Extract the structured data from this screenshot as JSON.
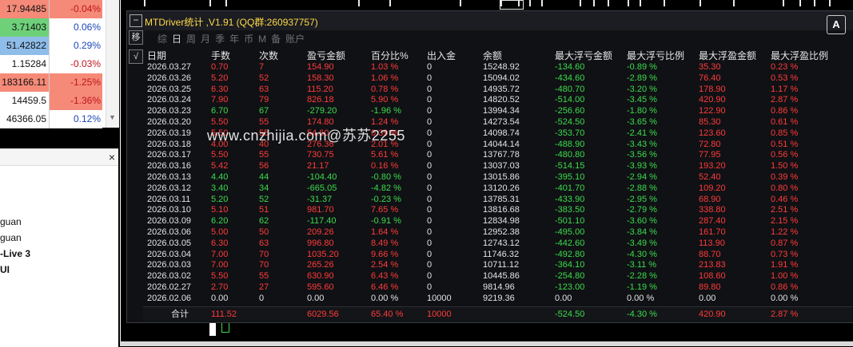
{
  "market_watch": {
    "rows": [
      {
        "price": "17.94485",
        "change": "-0.04%",
        "price_bg": "#f58a78",
        "change_bg": "#f58a78",
        "change_color": "#c0151c"
      },
      {
        "price": "3.71403",
        "change": "0.06%",
        "price_bg": "#6ed17a",
        "change_bg": "#ffffff",
        "change_color": "#1c47b7"
      },
      {
        "price": "51.42822",
        "change": "0.29%",
        "price_bg": "#8fbdea",
        "change_bg": "#ffffff",
        "change_color": "#1c47b7"
      },
      {
        "price": "1.15284",
        "change": "-0.03%",
        "price_bg": "#ffffff",
        "change_bg": "#ffffff",
        "change_color": "#c0151c"
      },
      {
        "price": "183166.11",
        "change": "-1.25%",
        "price_bg": "#f58a78",
        "change_bg": "#f58a78",
        "change_color": "#c0151c"
      },
      {
        "price": "14459.5",
        "change": "-1.36%",
        "price_bg": "#ffffff",
        "change_bg": "#f58a78",
        "change_color": "#c0151c"
      },
      {
        "price": "46366.05",
        "change": "0.12%",
        "price_bg": "#ffffff",
        "change_bg": "#ffffff",
        "change_color": "#1c47b7"
      }
    ]
  },
  "navigator": {
    "close_icon": "×",
    "items": [
      "guan",
      "guan",
      "-Live 3",
      "UI"
    ]
  },
  "panel": {
    "title": "MTDriver统计 ,V1.91 (QQ群:260937757)",
    "minimize_glyph": "−",
    "corner_icon": "A",
    "side_buttons": [
      "移",
      "√"
    ],
    "period_tabs": [
      "综",
      "日",
      "周",
      "月",
      "季",
      "年",
      "币",
      "M",
      "备",
      "账户"
    ],
    "active_tab": "日",
    "columns": [
      "日期",
      "手数",
      "次数",
      "盈亏金额",
      "百分比%",
      "出入金",
      "余额",
      "最大浮亏金额",
      "最大浮亏比例",
      "最大浮盈金额",
      "最大浮盈比例"
    ],
    "rows": [
      [
        "2026.03.27",
        "0.70",
        "7",
        "154.90",
        "1.03 %",
        "0",
        "15248.92",
        "-134.60",
        "-0.89 %",
        "35.30",
        "0.23 %"
      ],
      [
        "2026.03.26",
        "5.20",
        "52",
        "158.30",
        "1.06 %",
        "0",
        "15094.02",
        "-434.60",
        "-2.89 %",
        "76.40",
        "0.53 %"
      ],
      [
        "2026.03.25",
        "6.30",
        "63",
        "115.20",
        "0.78 %",
        "0",
        "14935.72",
        "-480.70",
        "-3.20 %",
        "178.90",
        "1.17 %"
      ],
      [
        "2026.03.24",
        "7.90",
        "79",
        "826.18",
        "5.90 %",
        "0",
        "14820.52",
        "-514.00",
        "-3.45 %",
        "420.90",
        "2.87 %"
      ],
      [
        "2026.03.23",
        "6.70",
        "67",
        "-279.20",
        "-1.96 %",
        "0",
        "13994.34",
        "-256.60",
        "-1.80 %",
        "122.90",
        "0.86 %"
      ],
      [
        "2026.03.20",
        "5.50",
        "55",
        "174.80",
        "1.24 %",
        "0",
        "14273.54",
        "-524.50",
        "-3.65 %",
        "85.30",
        "0.61 %"
      ],
      [
        "2026.03.19",
        "5.50",
        "55",
        "54.60",
        "0.39 %",
        "0",
        "14098.74",
        "-353.70",
        "-2.41 %",
        "123.60",
        "0.85 %"
      ],
      [
        "2026.03.18",
        "4.00",
        "40",
        "276.36",
        "2.01 %",
        "0",
        "14044.14",
        "-488.90",
        "-3.43 %",
        "72.80",
        "0.51 %"
      ],
      [
        "2026.03.17",
        "5.50",
        "55",
        "730.75",
        "5.61 %",
        "0",
        "13767.78",
        "-480.80",
        "-3.56 %",
        "77.95",
        "0.56 %"
      ],
      [
        "2026.03.16",
        "5.42",
        "56",
        "21.17",
        "0.16 %",
        "0",
        "13037.03",
        "-514.15",
        "-3.93 %",
        "193.20",
        "1.50 %"
      ],
      [
        "2026.03.13",
        "4.40",
        "44",
        "-104.40",
        "-0.80 %",
        "0",
        "13015.86",
        "-395.10",
        "-2.94 %",
        "52.40",
        "0.39 %"
      ],
      [
        "2026.03.12",
        "3.40",
        "34",
        "-665.05",
        "-4.82 %",
        "0",
        "13120.26",
        "-401.70",
        "-2.88 %",
        "109.20",
        "0.80 %"
      ],
      [
        "2026.03.11",
        "5.20",
        "52",
        "-31.37",
        "-0.23 %",
        "0",
        "13785.31",
        "-433.90",
        "-2.95 %",
        "68.90",
        "0.46 %"
      ],
      [
        "2026.03.10",
        "5.10",
        "51",
        "981.70",
        "7.65 %",
        "0",
        "13816.68",
        "-383.50",
        "-2.79 %",
        "338.80",
        "2.51 %"
      ],
      [
        "2026.03.09",
        "6.20",
        "62",
        "-117.40",
        "-0.91 %",
        "0",
        "12834.98",
        "-501.10",
        "-3.60 %",
        "287.40",
        "2.15 %"
      ],
      [
        "2026.03.06",
        "5.00",
        "50",
        "209.26",
        "1.64 %",
        "0",
        "12952.38",
        "-495.00",
        "-3.84 %",
        "161.70",
        "1.22 %"
      ],
      [
        "2026.03.05",
        "6.30",
        "63",
        "996.80",
        "8.49 %",
        "0",
        "12743.12",
        "-442.60",
        "-3.49 %",
        "113.90",
        "0.87 %"
      ],
      [
        "2026.03.04",
        "7.00",
        "70",
        "1035.20",
        "9.66 %",
        "0",
        "11746.32",
        "-492.80",
        "-4.30 %",
        "88.70",
        "0.73 %"
      ],
      [
        "2026.03.03",
        "7.00",
        "70",
        "265.26",
        "2.54 %",
        "0",
        "10711.12",
        "-364.10",
        "-3.11 %",
        "213.83",
        "1.91 %"
      ],
      [
        "2026.03.02",
        "5.50",
        "55",
        "630.90",
        "6.43 %",
        "0",
        "10445.86",
        "-254.80",
        "-2.28 %",
        "108.60",
        "1.00 %"
      ],
      [
        "2026.02.27",
        "2.70",
        "27",
        "595.60",
        "6.46 %",
        "0",
        "9814.96",
        "-123.00",
        "-1.19 %",
        "89.80",
        "0.86 %"
      ],
      [
        "2026.02.06",
        "0.00",
        "0",
        "0.00",
        "0.00 %",
        "10000",
        "9219.36",
        "0.00",
        "0.00 %",
        "0.00",
        "0.00 %"
      ]
    ],
    "total": {
      "label": "合计",
      "lots": "111.52",
      "profit": "6029.56",
      "percent": "65.40 %",
      "deposit": "10000",
      "max_float_loss": "-524.50",
      "max_float_loss_pct": "-4.30 %",
      "max_float_profit": "420.90",
      "max_float_profit_pct": "2.87 %"
    }
  },
  "watermark": "www.cnzhijia.com@苏苏2255",
  "colors": {
    "positive": "#ff3b3b",
    "negative": "#3bdc4e",
    "neutral": "#e3e3e3",
    "title": "#ffd84a"
  }
}
